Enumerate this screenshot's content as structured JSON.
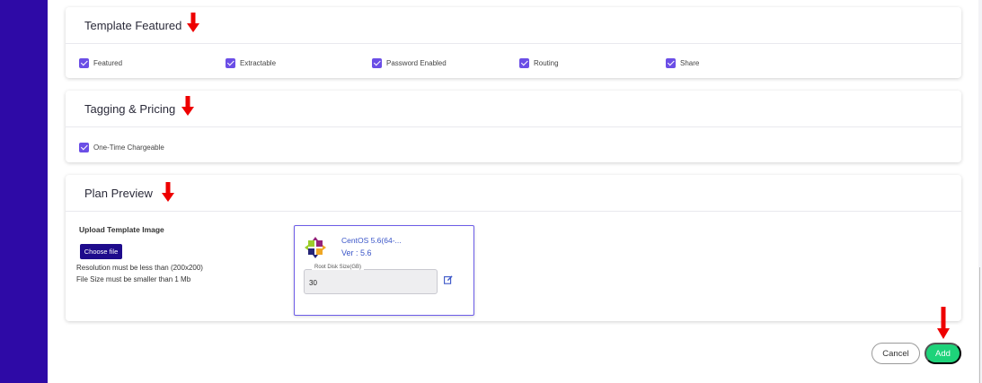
{
  "sections": {
    "template_featured": {
      "title": "Template Featured",
      "checkboxes": [
        {
          "label": "Featured",
          "checked": true
        },
        {
          "label": "Extractable",
          "checked": true
        },
        {
          "label": "Password Enabled",
          "checked": true
        },
        {
          "label": "Routing",
          "checked": true
        },
        {
          "label": "Share",
          "checked": true
        }
      ]
    },
    "tagging_pricing": {
      "title": "Tagging & Pricing",
      "checkboxes": [
        {
          "label": "One-Time Chargeable",
          "checked": true
        }
      ]
    },
    "plan_preview": {
      "title": "Plan Preview",
      "upload_title": "Upload Template Image",
      "choose_file_label": "Choose file",
      "hint_resolution": "Resolution must be less than (200x200)",
      "hint_size": "File Size must be smaller than 1 Mb",
      "preview": {
        "name": "CentOS 5.6(64-...",
        "version": "Ver : 5.6",
        "disk_label": "Root Disk Size(GB)",
        "disk_value": "30"
      }
    }
  },
  "actions": {
    "cancel_label": "Cancel",
    "add_label": "Add"
  },
  "colors": {
    "sidebar": "#2e0aa6",
    "checkbox": "#6b4ee6",
    "annotation_arrow": "#ee0000",
    "add_button": "#1ed37a",
    "choose_button": "#1e0b8c"
  },
  "icons": {
    "annotation": "arrow-down-icon",
    "logo": "centos-logo-icon",
    "edit": "edit-icon"
  }
}
